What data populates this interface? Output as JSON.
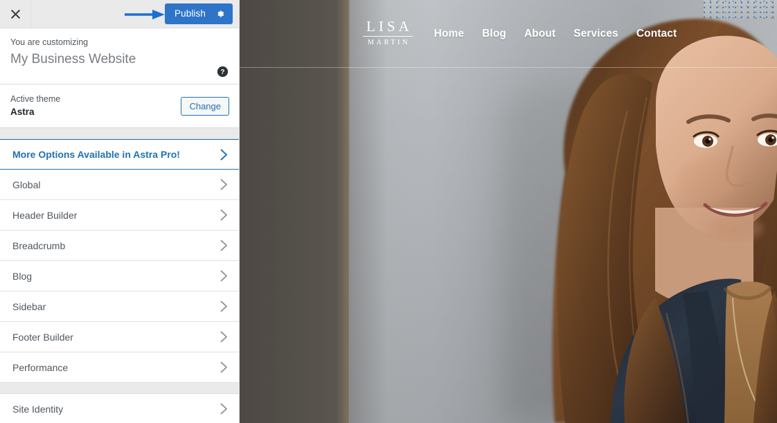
{
  "customizer": {
    "topbar": {
      "close_icon": "close-x-icon",
      "publish_label": "Publish",
      "publish_gear_icon": "gear-icon",
      "publish_color": "#2e74c8",
      "annotation_arrow_color": "#1a6fd4"
    },
    "info": {
      "eyebrow": "You are customizing",
      "site_title": "My Business Website",
      "help_icon": "help-circle-icon"
    },
    "theme": {
      "label": "Active theme",
      "name": "Astra",
      "change_label": "Change"
    },
    "panels": [
      {
        "label": "More Options Available in Astra Pro!",
        "highlight": true,
        "color": "#2271b1"
      },
      {
        "label": "Global",
        "highlight": false
      },
      {
        "label": "Header Builder",
        "highlight": false
      },
      {
        "label": "Breadcrumb",
        "highlight": false
      },
      {
        "label": "Blog",
        "highlight": false
      },
      {
        "label": "Sidebar",
        "highlight": false
      },
      {
        "label": "Footer Builder",
        "highlight": false
      },
      {
        "label": "Performance",
        "highlight": false
      },
      {
        "label": "Site Identity",
        "highlight": false
      }
    ],
    "chevron_icon": "chevron-right-icon"
  },
  "preview": {
    "logo": {
      "primary": "LISA",
      "secondary": "MARTIN"
    },
    "nav": [
      {
        "label": "Home"
      },
      {
        "label": "Blog"
      },
      {
        "label": "About"
      },
      {
        "label": "Services"
      },
      {
        "label": "Contact"
      }
    ],
    "hero": {
      "description": "Photograph of a smiling woman with long brown hair wearing a navy blazer over a tan top with a long pendant necklace, standing against a light gray wall",
      "wall_color": "#a9adb1",
      "blazer_color": "#2b3442",
      "top_color": "#9a7248",
      "hair_color": "#6b4226"
    }
  }
}
